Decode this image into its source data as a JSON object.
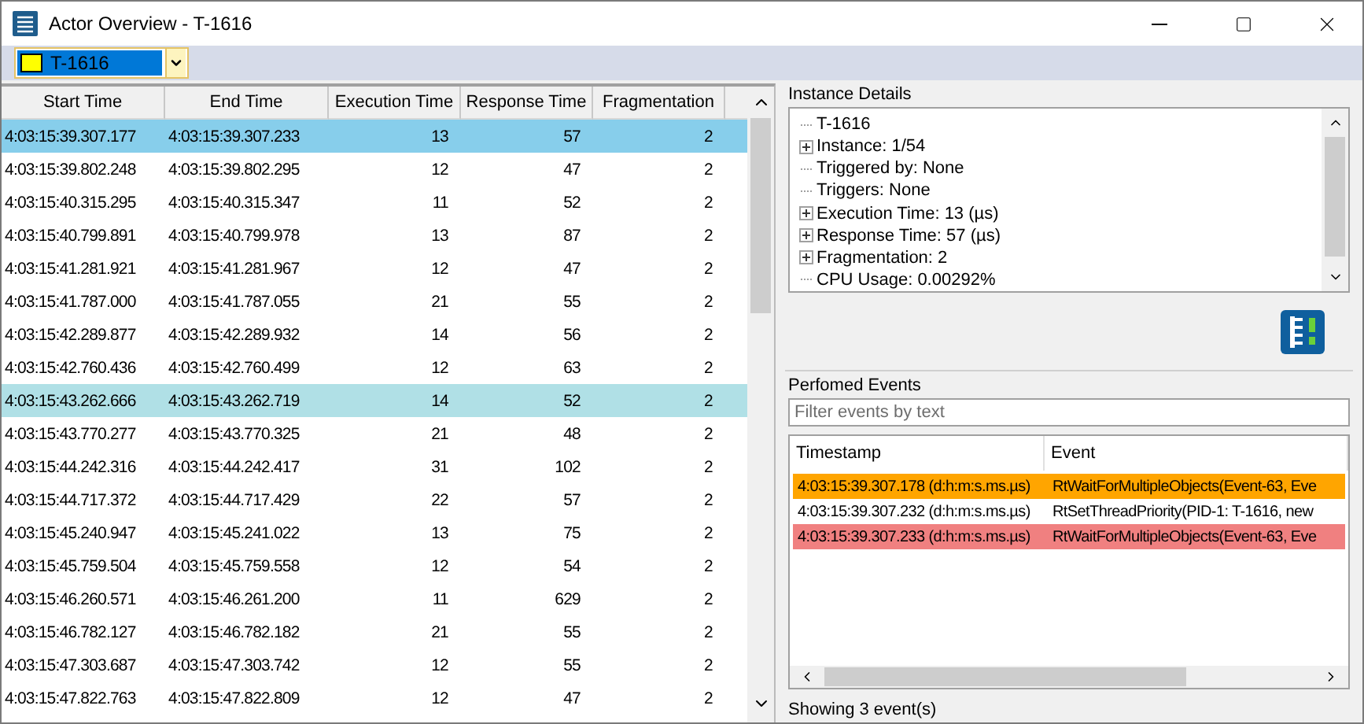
{
  "window": {
    "title": "Actor Overview - T-1616"
  },
  "actor_selector": {
    "value": "T-1616",
    "color": "#ffff00"
  },
  "table": {
    "columns": [
      "Start Time",
      "End Time",
      "Execution Time",
      "Response Time",
      "Fragmentation"
    ],
    "rows": [
      {
        "cells": [
          "4:03:15:39.307.177",
          "4:03:15:39.307.233",
          "13",
          "57",
          "2"
        ],
        "selected": true,
        "highlighted": false
      },
      {
        "cells": [
          "4:03:15:39.802.248",
          "4:03:15:39.802.295",
          "12",
          "47",
          "2"
        ],
        "selected": false,
        "highlighted": false
      },
      {
        "cells": [
          "4:03:15:40.315.295",
          "4:03:15:40.315.347",
          "11",
          "52",
          "2"
        ],
        "selected": false,
        "highlighted": false
      },
      {
        "cells": [
          "4:03:15:40.799.891",
          "4:03:15:40.799.978",
          "13",
          "87",
          "2"
        ],
        "selected": false,
        "highlighted": false
      },
      {
        "cells": [
          "4:03:15:41.281.921",
          "4:03:15:41.281.967",
          "12",
          "47",
          "2"
        ],
        "selected": false,
        "highlighted": false
      },
      {
        "cells": [
          "4:03:15:41.787.000",
          "4:03:15:41.787.055",
          "21",
          "55",
          "2"
        ],
        "selected": false,
        "highlighted": false
      },
      {
        "cells": [
          "4:03:15:42.289.877",
          "4:03:15:42.289.932",
          "14",
          "56",
          "2"
        ],
        "selected": false,
        "highlighted": false
      },
      {
        "cells": [
          "4:03:15:42.760.436",
          "4:03:15:42.760.499",
          "12",
          "63",
          "2"
        ],
        "selected": false,
        "highlighted": false
      },
      {
        "cells": [
          "4:03:15:43.262.666",
          "4:03:15:43.262.719",
          "14",
          "52",
          "2"
        ],
        "selected": false,
        "highlighted": true
      },
      {
        "cells": [
          "4:03:15:43.770.277",
          "4:03:15:43.770.325",
          "21",
          "48",
          "2"
        ],
        "selected": false,
        "highlighted": false
      },
      {
        "cells": [
          "4:03:15:44.242.316",
          "4:03:15:44.242.417",
          "31",
          "102",
          "2"
        ],
        "selected": false,
        "highlighted": false
      },
      {
        "cells": [
          "4:03:15:44.717.372",
          "4:03:15:44.717.429",
          "22",
          "57",
          "2"
        ],
        "selected": false,
        "highlighted": false
      },
      {
        "cells": [
          "4:03:15:45.240.947",
          "4:03:15:45.241.022",
          "13",
          "75",
          "2"
        ],
        "selected": false,
        "highlighted": false
      },
      {
        "cells": [
          "4:03:15:45.759.504",
          "4:03:15:45.759.558",
          "12",
          "54",
          "2"
        ],
        "selected": false,
        "highlighted": false
      },
      {
        "cells": [
          "4:03:15:46.260.571",
          "4:03:15:46.261.200",
          "11",
          "629",
          "2"
        ],
        "selected": false,
        "highlighted": false
      },
      {
        "cells": [
          "4:03:15:46.782.127",
          "4:03:15:46.782.182",
          "21",
          "55",
          "2"
        ],
        "selected": false,
        "highlighted": false
      },
      {
        "cells": [
          "4:03:15:47.303.687",
          "4:03:15:47.303.742",
          "12",
          "55",
          "2"
        ],
        "selected": false,
        "highlighted": false
      },
      {
        "cells": [
          "4:03:15:47.822.763",
          "4:03:15:47.822.809",
          "12",
          "47",
          "2"
        ],
        "selected": false,
        "highlighted": false
      }
    ]
  },
  "instance_details": {
    "title": "Instance Details",
    "items": [
      {
        "label": "T-1616",
        "expandable": false
      },
      {
        "label": "Instance: 1/54",
        "expandable": true
      },
      {
        "label": "Triggered by: None",
        "expandable": false
      },
      {
        "label": "Triggers: None",
        "expandable": false
      },
      {
        "label": "Execution Time: 13 (µs)",
        "expandable": true
      },
      {
        "label": "Response Time: 57 (µs)",
        "expandable": true
      },
      {
        "label": "Fragmentation: 2",
        "expandable": true
      },
      {
        "label": "CPU Usage: 0.00292%",
        "expandable": false
      }
    ]
  },
  "performed_events": {
    "title": "Perfomed Events",
    "filter": {
      "placeholder": "Filter events by text"
    },
    "columns": [
      "Timestamp",
      "Event"
    ],
    "rows": [
      {
        "timestamp": "4:03:15:39.307.178 (d:h:m:s.ms.µs)",
        "event": "RtWaitForMultipleObjects(Event-63, Eve",
        "color": "#ffa500"
      },
      {
        "timestamp": "4:03:15:39.307.232 (d:h:m:s.ms.µs)",
        "event": "RtSetThreadPriority(PID-1: T-1616, new",
        "color": "#ffffff"
      },
      {
        "timestamp": "4:03:15:39.307.233 (d:h:m:s.ms.µs)",
        "event": "RtWaitForMultipleObjects(Event-63, Eve",
        "color": "#f08080"
      }
    ],
    "status": "Showing 3 event(s)"
  }
}
